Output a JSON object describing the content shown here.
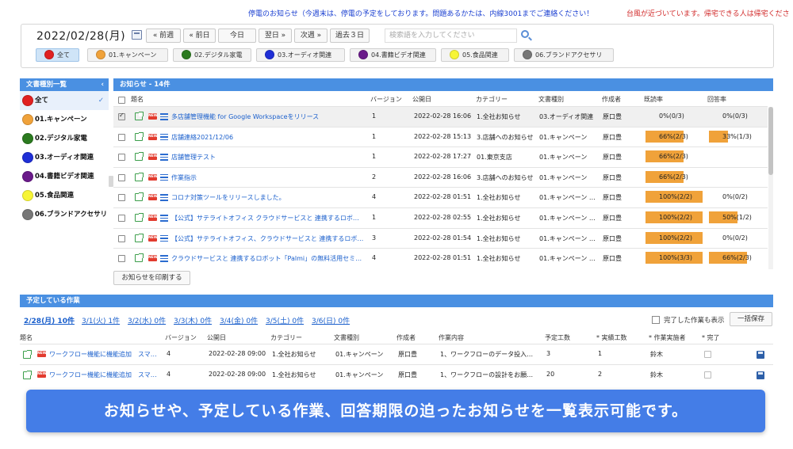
{
  "ticker": {
    "message1": "停電のお知らせ（今週末は、停電の予定をしております。問題あるかたは、内線3001までご連絡ください！",
    "message2": "台風が近づいています。帰宅できる人は帰宅くださ"
  },
  "toolbar": {
    "date": "2022/02/28(月)",
    "prev_week": "« 前週",
    "prev_day": "« 前日",
    "today": "今日",
    "next_day": "翌日 »",
    "next_week": "次週 »",
    "past_3_days": "過去３日",
    "search_placeholder": "検索語を入力してください"
  },
  "categories": [
    {
      "label": "全て",
      "color": "#e02020",
      "selected": true
    },
    {
      "label": "01.キャンペーン",
      "color": "#f0a23a"
    },
    {
      "label": "02.デジタル家電",
      "color": "#2b7a1f"
    },
    {
      "label": "03.オーディオ関連",
      "color": "#1f2fd6"
    },
    {
      "label": "04.書籍ビデオ関連",
      "color": "#6a1a8a"
    },
    {
      "label": "05.食品関連",
      "color": "#f7f536"
    },
    {
      "label": "06.ブランドアクセサリ",
      "color": "#777777"
    }
  ],
  "sidebar": {
    "title": "文書種別一覧",
    "collapse_glyph": "‹",
    "items": [
      {
        "label": "全て",
        "color": "#e02020",
        "active": true
      },
      {
        "label": "01.キャンペーン",
        "color": "#f0a23a"
      },
      {
        "label": "02.デジタル家電",
        "color": "#2b7a1f"
      },
      {
        "label": "03.オーディオ関連",
        "color": "#1f2fd6"
      },
      {
        "label": "04.書籍ビデオ関連",
        "color": "#6a1a8a"
      },
      {
        "label": "05.食品関連",
        "color": "#f7f536"
      },
      {
        "label": "06.ブランドアクセサリ",
        "color": "#777777"
      }
    ]
  },
  "notices": {
    "title": "お知らせ - 14件",
    "columns": {
      "title": "題名",
      "version": "バージョン",
      "published": "公開日",
      "category": "カテゴリー",
      "doc_type": "文書種別",
      "author": "作成者",
      "read_rate": "既読率",
      "answer_rate": "回答率"
    },
    "rows": [
      {
        "checked": true,
        "title": "多店舗管理機能 for Google Workspaceをリリース",
        "version": "1",
        "published": "2022-02-28 16:06",
        "category": "1.全社お知らせ",
        "doc_type": "03.オーディオ関連",
        "author": "原口豊",
        "read_label": "0%(0/3)",
        "read_pct": 0,
        "answer_label": "0%(0/3)",
        "answer_pct": 0
      },
      {
        "checked": false,
        "title": "店舗連絡2021/12/06",
        "version": "1",
        "published": "2022-02-28 15:13",
        "category": "3.店舗へのお知らせ",
        "doc_type": "01.キャンペーン",
        "author": "原口豊",
        "read_label": "66%(2/3)",
        "read_pct": 66,
        "answer_label": "33%(1/3)",
        "answer_pct": 33
      },
      {
        "checked": false,
        "title": "店舗管理テスト",
        "version": "1",
        "published": "2022-02-28 17:27",
        "category": "01.東京支店",
        "doc_type": "01.キャンペーン",
        "author": "原口豊",
        "read_label": "66%(2/3)",
        "read_pct": 66,
        "answer_label": "",
        "answer_pct": null
      },
      {
        "checked": false,
        "title": "作業指示",
        "version": "2",
        "published": "2022-02-28 16:06",
        "category": "3.店舗へのお知らせ",
        "doc_type": "01.キャンペーン",
        "author": "原口豊",
        "read_label": "66%(2/3)",
        "read_pct": 66,
        "answer_label": "",
        "answer_pct": null
      },
      {
        "checked": false,
        "title": "コロナ対策ツールをリリースしました。",
        "version": "4",
        "published": "2022-02-28 01:51",
        "category": "1.全社お知らせ",
        "doc_type": "01.キャンペーン …",
        "author": "原口豊",
        "read_label": "100%(2/2)",
        "read_pct": 100,
        "answer_label": "0%(0/2)",
        "answer_pct": 0
      },
      {
        "checked": false,
        "title": "【公式】サテライトオフィス クラウドサービスと 連携するロボ…",
        "version": "1",
        "published": "2022-02-28 02:55",
        "category": "1.全社お知らせ",
        "doc_type": "01.キャンペーン …",
        "author": "原口豊",
        "read_label": "100%(2/2)",
        "read_pct": 100,
        "answer_label": "50%(1/2)",
        "answer_pct": 50
      },
      {
        "checked": false,
        "title": "【公式】サテライトオフィス、クラウドサービスと 連携するロボ…",
        "version": "3",
        "published": "2022-02-28 01:54",
        "category": "1.全社お知らせ",
        "doc_type": "01.キャンペーン …",
        "author": "原口豊",
        "read_label": "100%(2/2)",
        "read_pct": 100,
        "answer_label": "0%(0/2)",
        "answer_pct": 0
      },
      {
        "checked": false,
        "title": "クラウドサービスと 連携するロボット「Palmi」の無料活用セミ…",
        "version": "4",
        "published": "2022-02-28 01:51",
        "category": "1.全社お知らせ",
        "doc_type": "01.キャンペーン …",
        "author": "原口豊",
        "read_label": "100%(3/3)",
        "read_pct": 100,
        "answer_label": "66%(2/3)",
        "answer_pct": 66
      }
    ],
    "print_button": "お知らせを印刷する"
  },
  "schedule": {
    "title": "予定している作業",
    "days": [
      "2/28(月) 10件",
      "3/1(火) 1件",
      "3/2(水) 0件",
      "3/3(木) 0件",
      "3/4(金) 0件",
      "3/5(土) 0件",
      "3/6(日) 0件"
    ],
    "show_done_label": "完了した作業も表示",
    "save_all": "一括保存",
    "columns": {
      "title": "題名",
      "version": "バージョン",
      "published": "公開日",
      "category": "カテゴリー",
      "doc_type": "文書種別",
      "author": "作成者",
      "content": "作業内容",
      "planned": "予定工数",
      "actual": "* 実績工数",
      "worker": "* 作業実施者",
      "done": "* 完了"
    },
    "rows": [
      {
        "title": "ワークフロー機能に機能追加　スマ…",
        "version": "4",
        "published": "2022-02-28 09:00",
        "category": "1.全社お知らせ",
        "doc_type": "01.キャンペーン",
        "author": "原口豊",
        "content": "1、ワークフローのデータ投入…",
        "planned": "3",
        "actual": "1",
        "worker": "鈴木"
      },
      {
        "title": "ワークフロー機能に機能追加　スマ…",
        "version": "4",
        "published": "2022-02-28 09:00",
        "category": "1.全社お知らせ",
        "doc_type": "01.キャンペーン",
        "author": "原口豊",
        "content": "1、ワークフローの設計をお願…",
        "planned": "20",
        "actual": "2",
        "worker": "鈴木"
      }
    ]
  },
  "caption": "お知らせや、予定している作業、回答期限の迫ったお知らせを一覧表示可能です。"
}
